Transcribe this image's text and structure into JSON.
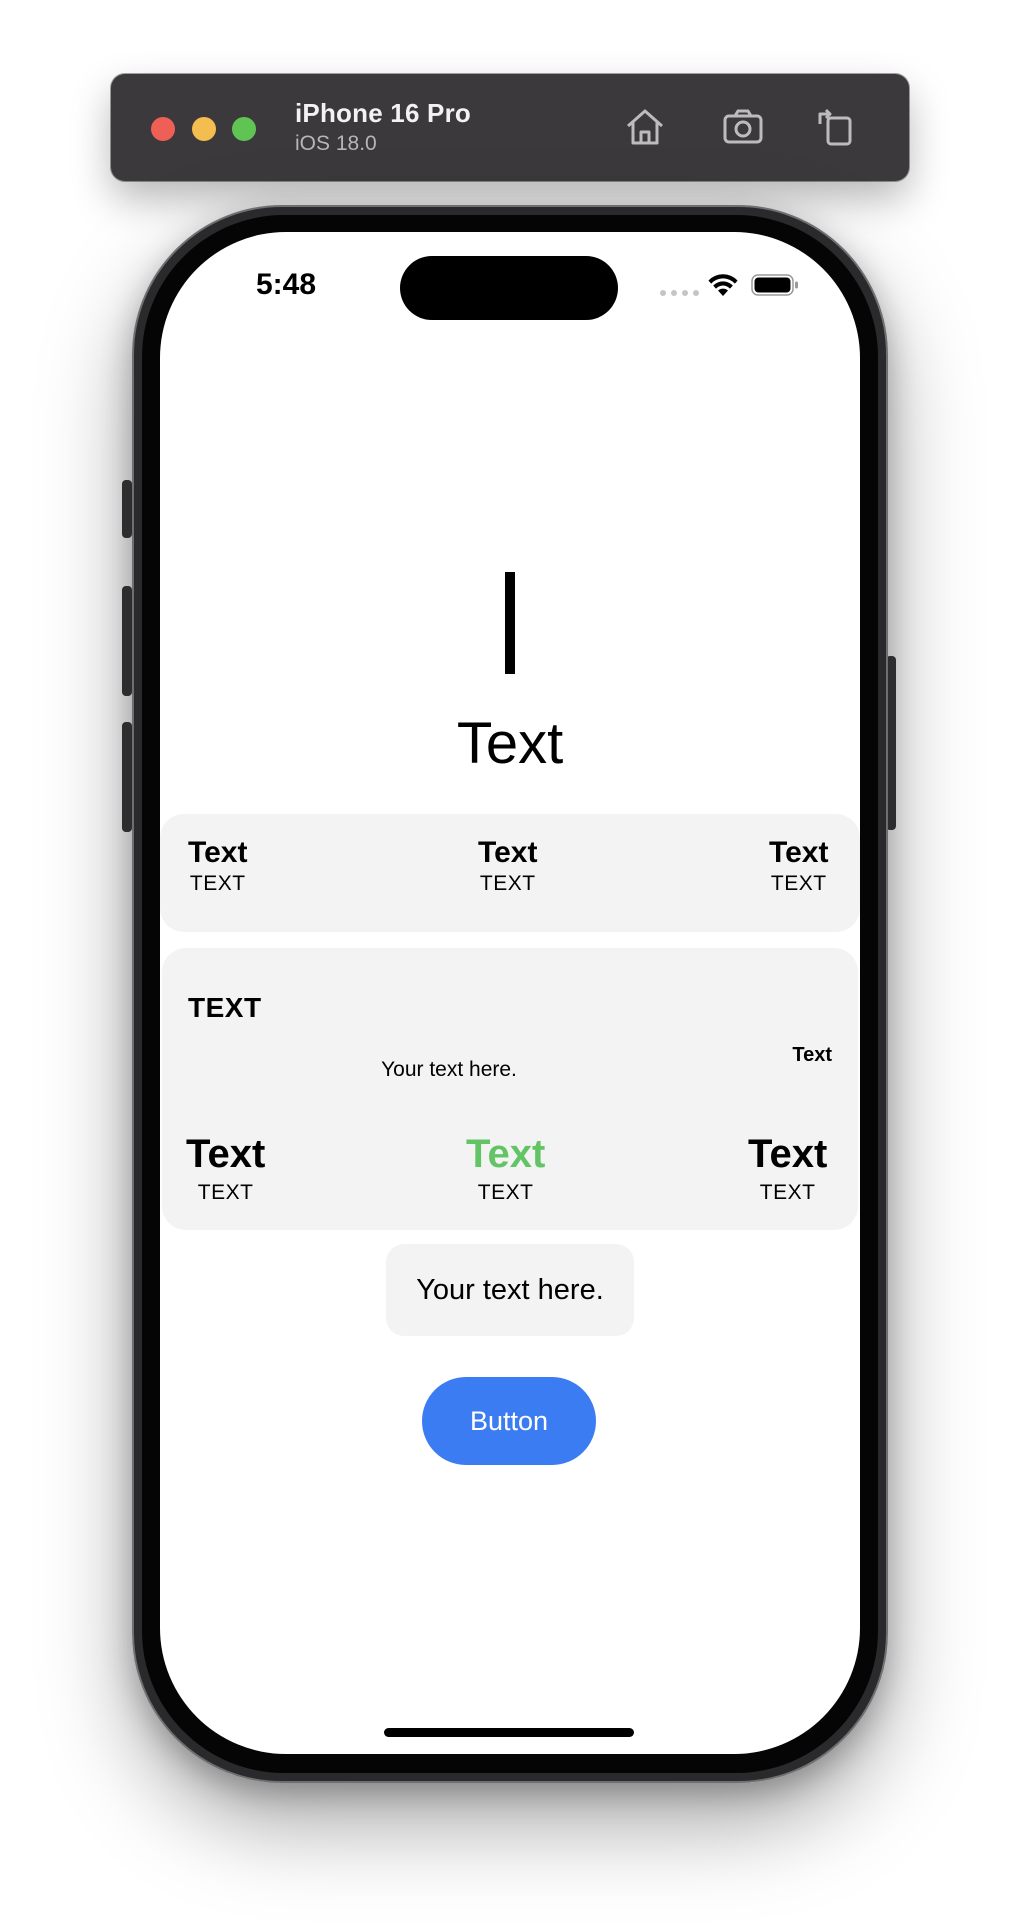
{
  "simulator": {
    "device_name": "iPhone 16 Pro",
    "os_version": "iOS 18.0",
    "icons": [
      "home-icon",
      "screenshot-icon",
      "rotate-icon"
    ]
  },
  "status_bar": {
    "time": "5:48"
  },
  "hero": {
    "label": "Text"
  },
  "row_panel": {
    "items": [
      {
        "title": "Text",
        "caption": "TEXT"
      },
      {
        "title": "Text",
        "caption": "TEXT"
      },
      {
        "title": "Text",
        "caption": "TEXT"
      }
    ]
  },
  "info_panel": {
    "heading": "TEXT",
    "corner_label": "Text",
    "body": "Your text here.",
    "items": [
      {
        "title": "Text",
        "caption": "TEXT"
      },
      {
        "title": "Text",
        "caption": "TEXT",
        "accent": "#63c466"
      },
      {
        "title": "Text",
        "caption": "TEXT"
      }
    ]
  },
  "pill": {
    "text": "Your text here."
  },
  "primary_button": {
    "label": "Button",
    "color": "#3b7cf3"
  }
}
